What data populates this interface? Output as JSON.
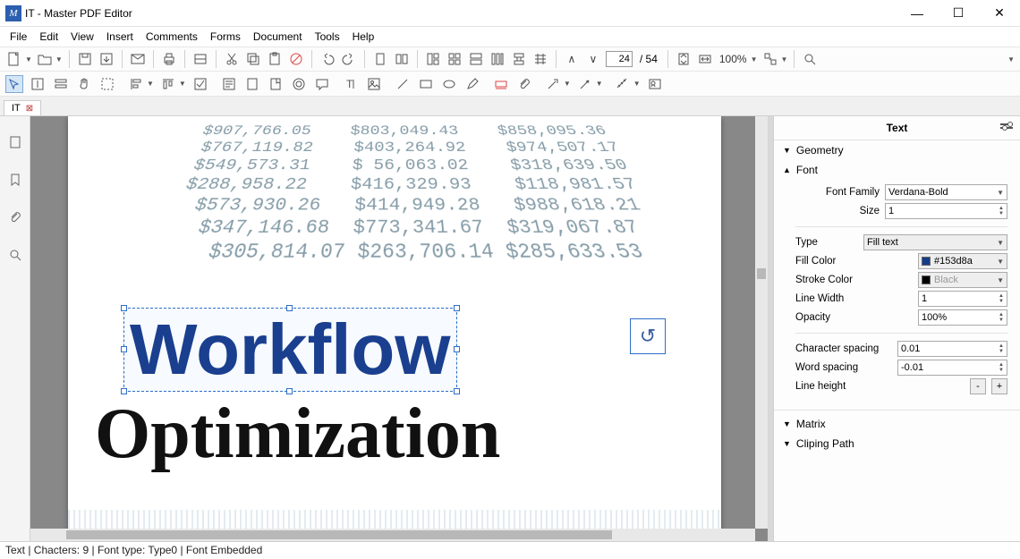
{
  "window": {
    "title": "IT - Master PDF Editor"
  },
  "menu": [
    "File",
    "Edit",
    "View",
    "Insert",
    "Comments",
    "Forms",
    "Document",
    "Tools",
    "Help"
  ],
  "page_nav": {
    "current": "24",
    "total": "54"
  },
  "zoom": "100%",
  "tab": {
    "name": "IT"
  },
  "document": {
    "bg_numbers": "  $907,766.05    $803,049.43    $858,095.36\n   $767,119.82    $403,264.92    $974,507.17\n   $549,573.31    $ 56,063.02    $318,639.50\n   $288,958.22    $416,329.93    $118,981.57\n    $573,930.26   $414,949.28   $988,618.21\n    $347,146.68  $773,341.67  $319,067.87\n     $305,814.07 $263,706.14 $285,633.53",
    "selected_text": "Workflow",
    "other_text": "Optimization"
  },
  "props": {
    "panel_title": "Text",
    "sections": {
      "geometry": "Geometry",
      "font": "Font",
      "matrix": "Matrix",
      "clip": "Cliping Path"
    },
    "labels": {
      "font_family": "Font Family",
      "size": "Size",
      "type": "Type",
      "fill_color": "Fill Color",
      "stroke_color": "Stroke Color",
      "line_width": "Line Width",
      "opacity": "Opacity",
      "char_spacing": "Character spacing",
      "word_spacing": "Word spacing",
      "line_height": "Line height"
    },
    "values": {
      "font_family": "Verdana-Bold",
      "size": "1",
      "type": "Fill text",
      "fill_color_label": "#153d8a",
      "fill_color_hex": "#153d8a",
      "stroke_color_label": "Black",
      "stroke_color_hex": "#000000",
      "line_width": "1",
      "opacity": "100%",
      "char_spacing": "0.01",
      "word_spacing": "-0.01",
      "line_height_minus": "-",
      "line_height_plus": "+"
    }
  },
  "status": "Text | Chacters: 9 | Font type: Type0 | Font Embedded"
}
